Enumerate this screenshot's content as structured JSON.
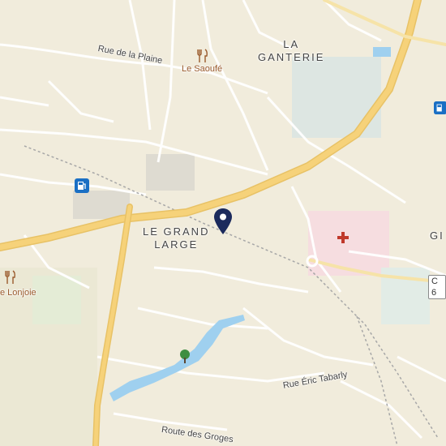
{
  "map": {
    "places": {
      "la_ganterie": [
        "LA",
        "GANTERIE"
      ],
      "le_grand_large": [
        "LE GRAND",
        "LARGE"
      ],
      "gi": "GI"
    },
    "pois": {
      "le_saoufe": "Le Saoufé",
      "le_lonjoie": "e Lonjoie"
    },
    "roads": {
      "rue_de_la_plaine": "Rue de la Plaine",
      "rue_eric_tabarly": "Rue Éric Tabarly",
      "route_des_groges": "Route des Groges"
    },
    "shield": "C 6",
    "icons": [
      "restaurant-icon",
      "fuel-station-icon",
      "hospital-icon",
      "tree-icon",
      "location-pin-icon"
    ],
    "colors": {
      "background": "#f2eee2",
      "main_road": "#f6d27a",
      "water": "#9fd0ef",
      "hospital": "#c0392b",
      "fuel": "#1a6fc4",
      "pin": "#1b2a5c"
    }
  }
}
